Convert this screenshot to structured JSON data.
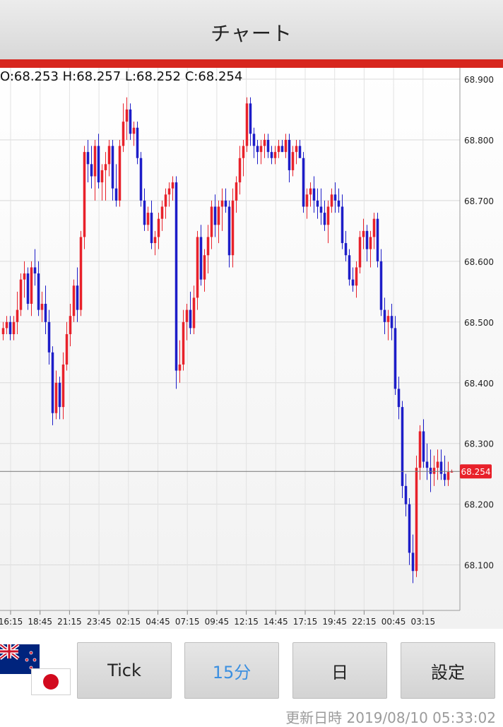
{
  "header": {
    "title": "チャート"
  },
  "ohlc": "O:68.253 H:68.257 L:68.252 C:68.254",
  "current_price": "68.254",
  "buttons": [
    {
      "label": "Tick",
      "active": false
    },
    {
      "label": "15分",
      "active": true
    },
    {
      "label": "日",
      "active": false
    },
    {
      "label": "設定",
      "active": false
    }
  ],
  "updated": "更新日時 2019/08/10 05:33:02",
  "flags": [
    "new-zealand-flag-icon",
    "japan-flag-icon"
  ],
  "colors": {
    "up": "#e8212a",
    "down": "#1d1dc8",
    "accent": "#d7261e",
    "active": "#3b8fe0"
  },
  "chart_data": {
    "type": "candlestick",
    "ylim": [
      68.04,
      68.92
    ],
    "y_ticks": [
      "68.900",
      "68.800",
      "68.700",
      "68.600",
      "68.500",
      "68.400",
      "68.300",
      "68.200",
      "68.100"
    ],
    "x_ticks": [
      "16:15",
      "18:45",
      "21:15",
      "23:45",
      "02:15",
      "04:45",
      "07:15",
      "09:45",
      "12:15",
      "14:45",
      "17:15",
      "19:45",
      "22:15",
      "00:45",
      "03:15"
    ],
    "last_price": 68.254,
    "candles": [
      [
        68.48,
        68.5,
        68.47,
        68.49
      ],
      [
        68.49,
        68.51,
        68.48,
        68.5
      ],
      [
        68.5,
        68.51,
        68.47,
        68.48
      ],
      [
        68.48,
        68.51,
        68.47,
        68.5
      ],
      [
        68.5,
        68.55,
        68.48,
        68.52
      ],
      [
        68.52,
        68.58,
        68.51,
        68.57
      ],
      [
        68.57,
        68.6,
        68.54,
        68.58
      ],
      [
        68.58,
        68.59,
        68.52,
        68.53
      ],
      [
        68.53,
        68.6,
        68.51,
        68.59
      ],
      [
        68.59,
        68.62,
        68.56,
        68.58
      ],
      [
        68.58,
        68.6,
        68.51,
        68.52
      ],
      [
        68.52,
        68.55,
        68.5,
        68.53
      ],
      [
        68.53,
        68.56,
        68.48,
        68.5
      ],
      [
        68.5,
        68.52,
        68.43,
        68.45
      ],
      [
        68.45,
        68.46,
        68.33,
        68.35
      ],
      [
        68.35,
        68.42,
        68.34,
        68.4
      ],
      [
        68.4,
        68.41,
        68.34,
        68.36
      ],
      [
        68.36,
        68.45,
        68.34,
        68.43
      ],
      [
        68.43,
        68.5,
        68.42,
        68.48
      ],
      [
        68.48,
        68.53,
        68.46,
        68.51
      ],
      [
        68.51,
        68.57,
        68.5,
        68.56
      ],
      [
        68.56,
        68.59,
        68.5,
        68.52
      ],
      [
        68.52,
        68.65,
        68.51,
        68.64
      ],
      [
        68.64,
        68.79,
        68.62,
        68.78
      ],
      [
        68.78,
        68.8,
        68.73,
        68.76
      ],
      [
        68.76,
        68.79,
        68.72,
        68.74
      ],
      [
        68.74,
        68.8,
        68.7,
        68.79
      ],
      [
        68.79,
        68.81,
        68.72,
        68.73
      ],
      [
        68.73,
        68.76,
        68.7,
        68.75
      ],
      [
        68.75,
        68.78,
        68.7,
        68.76
      ],
      [
        68.76,
        68.8,
        68.74,
        68.79
      ],
      [
        68.79,
        68.8,
        68.7,
        68.72
      ],
      [
        68.72,
        68.76,
        68.69,
        68.7
      ],
      [
        68.7,
        68.8,
        68.69,
        68.79
      ],
      [
        68.79,
        68.86,
        68.78,
        68.83
      ],
      [
        68.83,
        68.87,
        68.8,
        68.85
      ],
      [
        68.85,
        68.86,
        68.8,
        68.81
      ],
      [
        68.81,
        68.83,
        68.79,
        68.82
      ],
      [
        68.82,
        68.83,
        68.76,
        68.77
      ],
      [
        68.77,
        68.78,
        68.69,
        68.7
      ],
      [
        68.7,
        68.72,
        68.65,
        68.66
      ],
      [
        68.66,
        68.69,
        68.65,
        68.68
      ],
      [
        68.68,
        68.7,
        68.62,
        68.63
      ],
      [
        68.63,
        68.65,
        68.61,
        68.64
      ],
      [
        68.64,
        68.68,
        68.62,
        68.67
      ],
      [
        68.67,
        68.7,
        68.65,
        68.69
      ],
      [
        68.69,
        68.72,
        68.67,
        68.71
      ],
      [
        68.71,
        68.73,
        68.69,
        68.72
      ],
      [
        68.72,
        68.74,
        68.7,
        68.73
      ],
      [
        68.73,
        68.74,
        68.39,
        68.42
      ],
      [
        68.42,
        68.47,
        68.4,
        68.43
      ],
      [
        68.43,
        68.52,
        68.42,
        68.5
      ],
      [
        68.5,
        68.53,
        68.47,
        68.52
      ],
      [
        68.52,
        68.55,
        68.48,
        68.49
      ],
      [
        68.49,
        68.56,
        68.48,
        68.54
      ],
      [
        68.54,
        68.65,
        68.52,
        68.64
      ],
      [
        68.64,
        68.66,
        68.56,
        68.57
      ],
      [
        68.57,
        68.62,
        68.55,
        68.61
      ],
      [
        68.61,
        68.66,
        68.58,
        68.64
      ],
      [
        68.64,
        68.7,
        68.62,
        68.69
      ],
      [
        68.69,
        68.71,
        68.64,
        68.66
      ],
      [
        68.66,
        68.7,
        68.63,
        68.69
      ],
      [
        68.69,
        68.72,
        68.65,
        68.7
      ],
      [
        68.7,
        68.72,
        68.68,
        68.69
      ],
      [
        68.69,
        68.7,
        68.59,
        68.61
      ],
      [
        68.61,
        68.72,
        68.59,
        68.7
      ],
      [
        68.7,
        68.74,
        68.68,
        68.73
      ],
      [
        68.73,
        68.79,
        68.71,
        68.77
      ],
      [
        68.77,
        68.8,
        68.74,
        68.79
      ],
      [
        68.79,
        68.87,
        68.78,
        68.86
      ],
      [
        68.86,
        68.87,
        68.79,
        68.81
      ],
      [
        68.81,
        68.82,
        68.77,
        68.79
      ],
      [
        68.79,
        68.8,
        68.76,
        68.78
      ],
      [
        68.78,
        68.8,
        68.76,
        68.79
      ],
      [
        68.79,
        68.81,
        68.77,
        68.8
      ],
      [
        68.8,
        68.81,
        68.77,
        68.78
      ],
      [
        68.78,
        68.79,
        68.76,
        68.77
      ],
      [
        68.77,
        68.79,
        68.76,
        68.78
      ],
      [
        68.78,
        68.8,
        68.77,
        68.79
      ],
      [
        68.79,
        68.8,
        68.78,
        68.78
      ],
      [
        68.78,
        68.81,
        68.77,
        68.8
      ],
      [
        68.8,
        68.81,
        68.73,
        68.75
      ],
      [
        68.75,
        68.79,
        68.74,
        68.78
      ],
      [
        68.78,
        68.8,
        68.76,
        68.79
      ],
      [
        68.79,
        68.8,
        68.77,
        68.77
      ],
      [
        68.77,
        68.78,
        68.68,
        68.69
      ],
      [
        68.69,
        68.72,
        68.67,
        68.71
      ],
      [
        68.71,
        68.73,
        68.69,
        68.72
      ],
      [
        68.72,
        68.74,
        68.68,
        68.7
      ],
      [
        68.7,
        68.72,
        68.67,
        68.69
      ],
      [
        68.69,
        68.72,
        68.66,
        68.68
      ],
      [
        68.68,
        68.7,
        68.65,
        68.66
      ],
      [
        68.66,
        68.7,
        68.63,
        68.69
      ],
      [
        68.69,
        68.72,
        68.68,
        68.71
      ],
      [
        68.71,
        68.73,
        68.68,
        68.7
      ],
      [
        68.7,
        68.72,
        68.68,
        68.69
      ],
      [
        68.69,
        68.71,
        68.62,
        68.63
      ],
      [
        68.63,
        68.65,
        68.6,
        68.61
      ],
      [
        68.61,
        68.62,
        68.56,
        68.57
      ],
      [
        68.57,
        68.59,
        68.55,
        68.56
      ],
      [
        68.56,
        68.6,
        68.54,
        68.59
      ],
      [
        68.59,
        68.65,
        68.58,
        68.64
      ],
      [
        68.64,
        68.67,
        68.62,
        68.65
      ],
      [
        68.65,
        68.66,
        68.6,
        68.62
      ],
      [
        68.62,
        68.65,
        68.59,
        68.64
      ],
      [
        68.64,
        68.68,
        68.62,
        68.67
      ],
      [
        68.67,
        68.68,
        68.59,
        68.6
      ],
      [
        68.6,
        68.62,
        68.51,
        68.52
      ],
      [
        68.52,
        68.54,
        68.48,
        68.5
      ],
      [
        68.5,
        68.52,
        68.47,
        68.51
      ],
      [
        68.51,
        68.53,
        68.47,
        68.49
      ],
      [
        68.49,
        68.51,
        68.38,
        68.39
      ],
      [
        68.39,
        68.41,
        68.34,
        68.36
      ],
      [
        68.36,
        68.37,
        68.21,
        68.23
      ],
      [
        68.23,
        68.25,
        68.18,
        68.2
      ],
      [
        68.2,
        68.21,
        68.1,
        68.12
      ],
      [
        68.12,
        68.15,
        68.07,
        68.09
      ],
      [
        68.09,
        68.28,
        68.08,
        68.26
      ],
      [
        68.26,
        68.33,
        68.24,
        68.32
      ],
      [
        68.32,
        68.34,
        68.26,
        68.27
      ],
      [
        68.27,
        68.3,
        68.24,
        68.26
      ],
      [
        68.26,
        68.29,
        68.22,
        68.25
      ],
      [
        68.25,
        68.28,
        68.23,
        68.26
      ],
      [
        68.26,
        68.29,
        68.24,
        68.27
      ],
      [
        68.27,
        68.29,
        68.24,
        68.25
      ],
      [
        68.25,
        68.28,
        68.23,
        68.24
      ],
      [
        68.24,
        68.27,
        68.23,
        68.253
      ],
      [
        68.253,
        68.257,
        68.252,
        68.254
      ]
    ]
  }
}
